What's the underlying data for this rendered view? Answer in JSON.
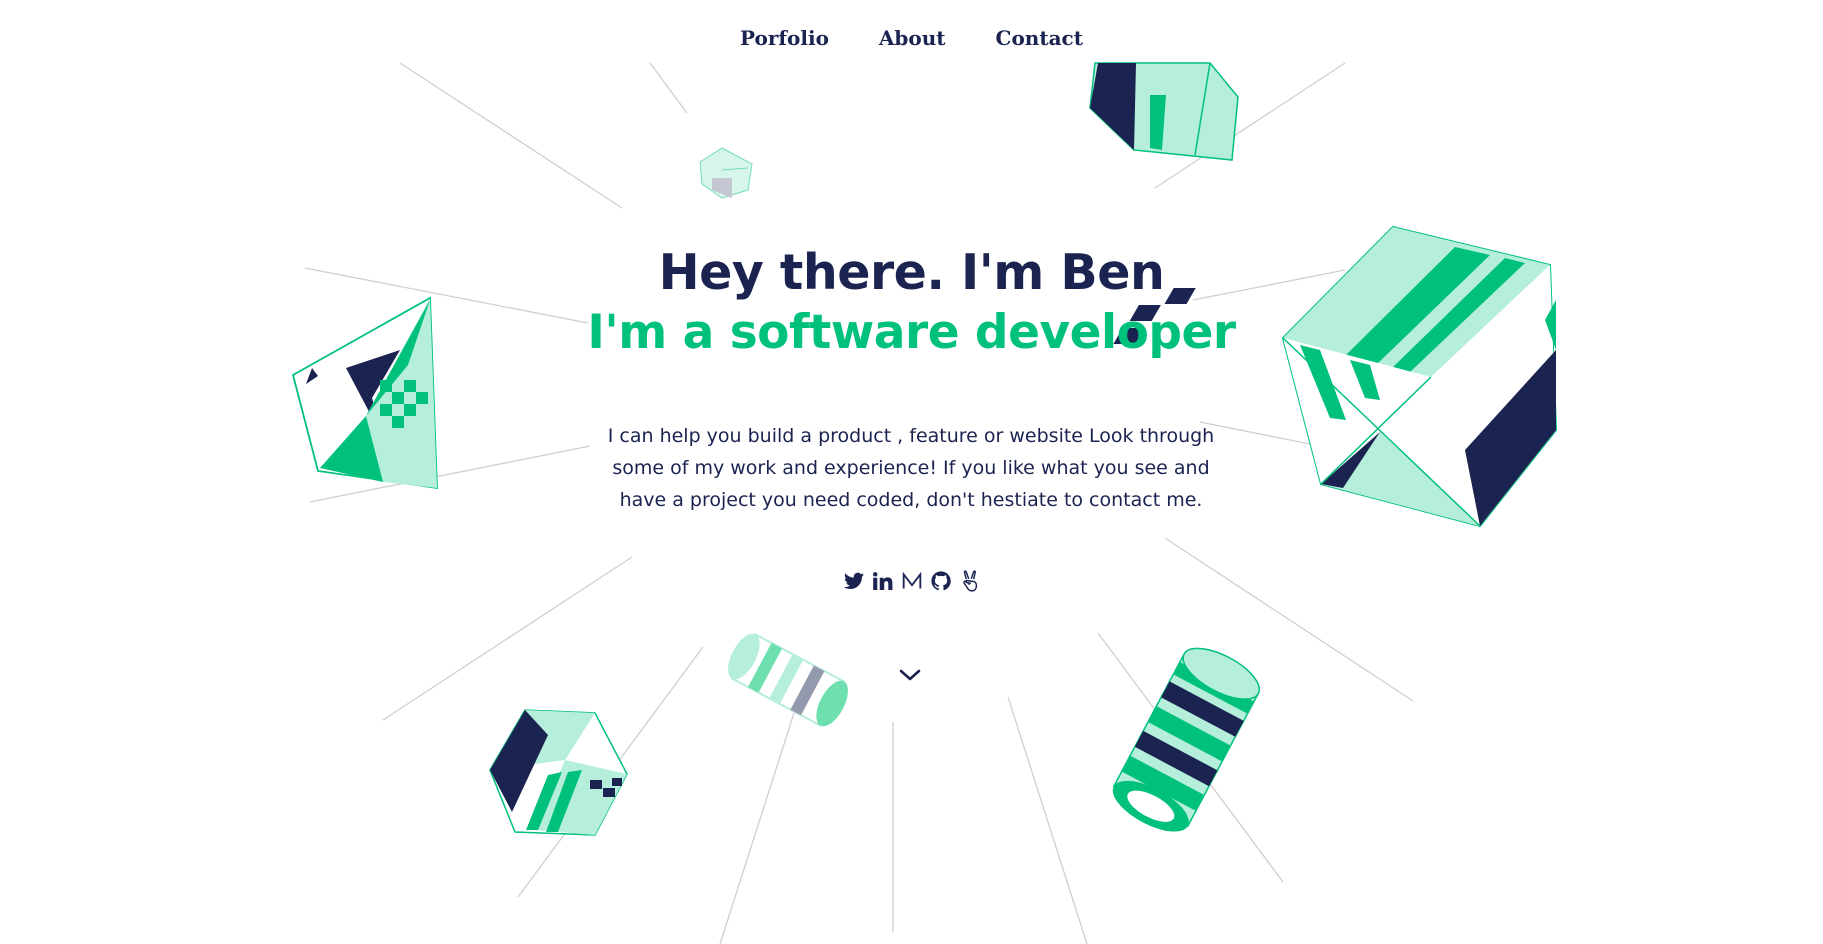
{
  "nav": {
    "items": [
      {
        "label": "Porfolio"
      },
      {
        "label": "About"
      },
      {
        "label": "Contact"
      }
    ]
  },
  "hero": {
    "greeting": "Hey there. I'm Ben",
    "role": "I'm a software developer",
    "intro": "I can help you build a product , feature or website Look through some of my work and experience! If you like what you see and have a project you need coded, don't hestiate to contact me."
  },
  "socials": [
    {
      "icon": "twitter-icon"
    },
    {
      "icon": "linkedin-icon"
    },
    {
      "icon": "medium-icon"
    },
    {
      "icon": "github-icon"
    },
    {
      "icon": "angellist-icon"
    }
  ],
  "scroll": {
    "icon": "chevron-down-icon"
  },
  "colors": {
    "navy": "#1b2350",
    "green": "#00c17c",
    "mint": "#b5eedb",
    "gray": "#949aae",
    "line": "#cfcfcf"
  }
}
